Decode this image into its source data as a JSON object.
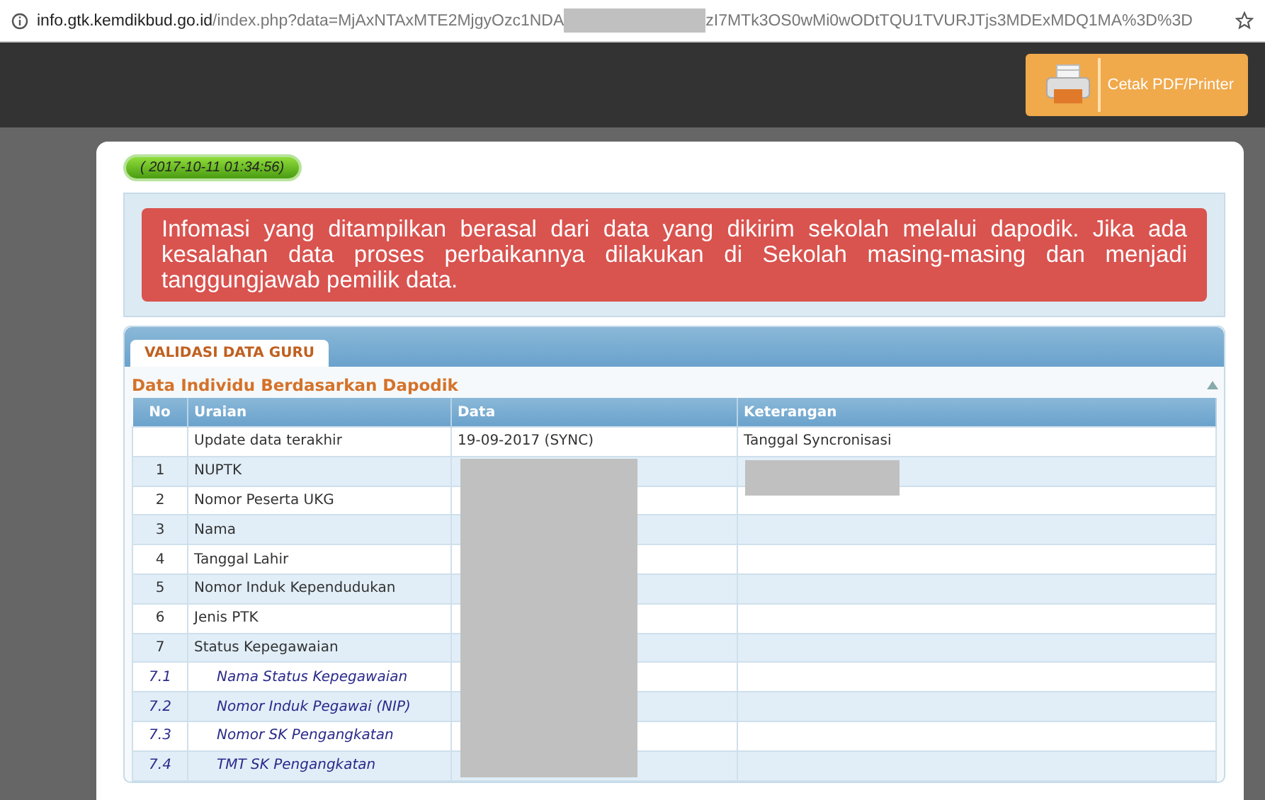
{
  "browser": {
    "url_host": "info.gtk.kemdikbud.go.id",
    "url_path_start": "/index.php?data=MjAxNTAxMTE2MjgyOzc1NDA",
    "url_path_end": "zI7MTk3OS0wMi0wODtTQU1TVURJTjs3MDExMDQ1MA%3D%3D"
  },
  "header": {
    "print_button": "Cetak PDF/Printer"
  },
  "timestamp": "( 2017-10-11 01:34:56)",
  "alert": "Infomasi yang ditampilkan berasal dari data yang dikirim sekolah melalui dapodik. Jika ada kesalahan data proses perbaikannya dilakukan di Sekolah masing-masing dan menjadi tanggungjawab pemilik data.",
  "tabs": [
    {
      "label": "VALIDASI DATA GURU",
      "selected": true
    }
  ],
  "section": {
    "title": "Data Individu Berdasarkan Dapodik",
    "expanded": true
  },
  "table": {
    "columns": [
      "No",
      "Uraian",
      "Data",
      "Keterangan"
    ],
    "rows": [
      {
        "kind": "main",
        "no": "",
        "label": "Update data terakhir",
        "data": "19-09-2017 (SYNC)",
        "note": "Tanggal Syncronisasi"
      },
      {
        "kind": "main",
        "no": "1",
        "label": "NUPTK",
        "data": "",
        "note": ""
      },
      {
        "kind": "main",
        "no": "2",
        "label": "Nomor Peserta UKG",
        "data": "",
        "note": ""
      },
      {
        "kind": "main",
        "no": "3",
        "label": "Nama",
        "data": "",
        "note": ""
      },
      {
        "kind": "main",
        "no": "4",
        "label": "Tanggal Lahir",
        "data": "",
        "note": ""
      },
      {
        "kind": "main",
        "no": "5",
        "label": "Nomor Induk Kependudukan",
        "data": "",
        "note": ""
      },
      {
        "kind": "main",
        "no": "6",
        "label": "Jenis PTK",
        "data": "",
        "note": ""
      },
      {
        "kind": "main",
        "no": "7",
        "label": "Status Kepegawaian",
        "data": "",
        "note": ""
      },
      {
        "kind": "sub",
        "no": "7.1",
        "label": "Nama Status Kepegawaian",
        "data": "",
        "note": ""
      },
      {
        "kind": "sub",
        "no": "7.2",
        "label": "Nomor Induk Pegawai (NIP)",
        "data": "",
        "note": ""
      },
      {
        "kind": "sub",
        "no": "7.3",
        "label": "Nomor SK Pengangkatan",
        "data": "",
        "note": ""
      },
      {
        "kind": "sub",
        "no": "7.4",
        "label": "TMT SK Pengangkatan",
        "data": "",
        "note": ""
      }
    ]
  }
}
